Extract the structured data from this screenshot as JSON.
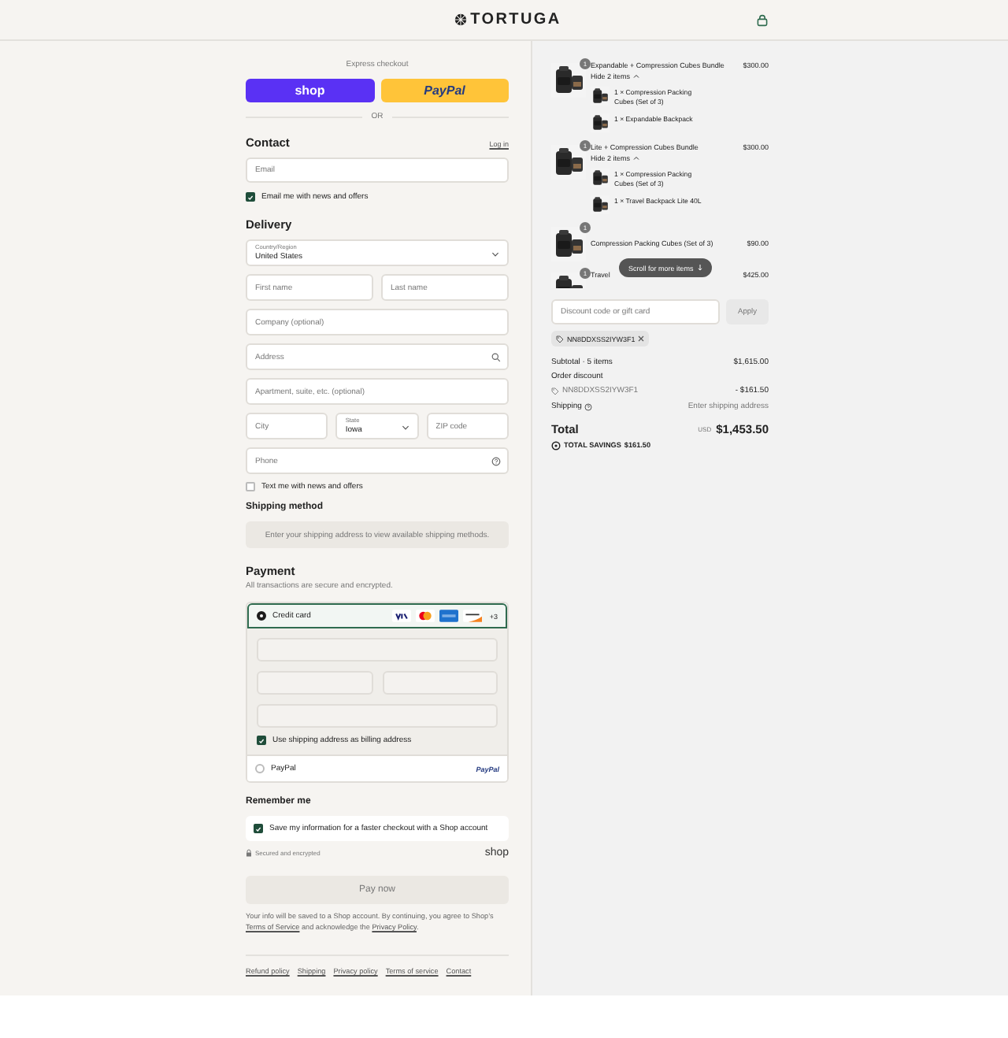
{
  "header": {
    "brand": "TORTUGA"
  },
  "express": {
    "label": "Express checkout",
    "buttons": [
      {
        "kind": "shop",
        "label": "shop"
      },
      {
        "kind": "paypal",
        "label": "PayPal"
      }
    ],
    "divider": "OR"
  },
  "contact": {
    "heading": "Contact",
    "login": "Log in",
    "email": {
      "placeholder": "Email"
    },
    "newsletter": {
      "label": "Email me with news and offers",
      "checked": true
    }
  },
  "delivery": {
    "heading": "Delivery",
    "rows": [
      [
        {
          "kind": "select",
          "label": "Country/Region",
          "value": "United States"
        }
      ],
      [
        {
          "kind": "text",
          "placeholder": "First name"
        },
        {
          "kind": "text",
          "placeholder": "Last name"
        }
      ],
      [
        {
          "kind": "text",
          "placeholder": "Company (optional)"
        }
      ],
      [
        {
          "kind": "search",
          "placeholder": "Address"
        }
      ],
      [
        {
          "kind": "text",
          "placeholder": "Apartment, suite, etc. (optional)"
        }
      ],
      [
        {
          "kind": "text",
          "placeholder": "City"
        },
        {
          "kind": "select",
          "label": "State",
          "value": "Iowa"
        },
        {
          "kind": "text",
          "placeholder": "ZIP code"
        }
      ],
      [
        {
          "kind": "help",
          "placeholder": "Phone"
        }
      ]
    ],
    "sms": {
      "label": "Text me with news and offers",
      "checked": false
    }
  },
  "shipping": {
    "heading": "Shipping method",
    "notice": "Enter your shipping address to view available shipping methods."
  },
  "payment": {
    "heading": "Payment",
    "subtitle": "All transactions are secure and encrypted.",
    "methods": [
      {
        "kind": "card",
        "label": "Credit card",
        "selected": true,
        "more": "+3"
      },
      {
        "kind": "paypal",
        "label": "PayPal",
        "selected": false,
        "logo": "PayPal"
      }
    ],
    "card_fields": [
      {
        "kind": "full"
      },
      {
        "kind": "half"
      },
      {
        "kind": "half"
      },
      {
        "kind": "full"
      }
    ],
    "billing": {
      "label": "Use shipping address as billing address",
      "checked": true
    }
  },
  "remember": {
    "heading": "Remember me",
    "save": {
      "label": "Save my information for a faster checkout with a Shop account",
      "checked": true
    },
    "secure": "Secured and encrypted",
    "logo": "shop"
  },
  "pay_button": {
    "label": "Pay now",
    "disabled": true
  },
  "legal": [
    {
      "kind": "text",
      "text": "Your info will be saved to a Shop account. By continuing, you agree to Shop’s "
    },
    {
      "kind": "link",
      "text": "Terms of Service"
    },
    {
      "kind": "text",
      "text": " and acknowledge the "
    },
    {
      "kind": "link",
      "text": "Privacy Policy"
    },
    {
      "kind": "text",
      "text": "."
    }
  ],
  "footer_links": [
    "Refund policy",
    "Shipping",
    "Privacy policy",
    "Terms of service",
    "Contact"
  ],
  "summary": {
    "items": [
      {
        "title": "Expandable + Compression Cubes Bundle",
        "quantity": "1",
        "price": "$300.00",
        "toggle": "Hide 2 items",
        "expanded": true,
        "children": [
          {
            "title": "1 × Compression Packing Cubes (Set of 3)"
          },
          {
            "title": "1 × Expandable Backpack"
          }
        ]
      },
      {
        "title": "Lite + Compression Cubes Bundle",
        "quantity": "1",
        "price": "$300.00",
        "toggle": "Hide 2 items",
        "expanded": true,
        "children": [
          {
            "title": "1 × Compression Packing Cubes (Set of 3)"
          },
          {
            "title": "1 × Travel Backpack Lite 40L"
          }
        ]
      },
      {
        "title": "Compression Packing Cubes (Set of 3)",
        "quantity": "1",
        "price": "$90.00"
      },
      {
        "title": "Travel",
        "quantity": "1",
        "price": "$425.00"
      }
    ],
    "scroll_hint": "Scroll for more items",
    "discount": {
      "placeholder": "Discount code or gift card",
      "apply": "Apply",
      "applied": "NN8DDXSS2IYW3F1"
    },
    "subtotal": {
      "label": "Subtotal · 5 items",
      "value": "$1,615.00"
    },
    "order_discount": {
      "label": "Order discount",
      "code": "NN8DDXSS2IYW3F1",
      "value": "- $161.50"
    },
    "shipping": {
      "label": "Shipping",
      "value": "Enter shipping address"
    },
    "total": {
      "label": "Total",
      "currency": "USD",
      "value": "$1,453.50"
    },
    "savings": {
      "label": "TOTAL SAVINGS",
      "value": "$161.50"
    }
  }
}
